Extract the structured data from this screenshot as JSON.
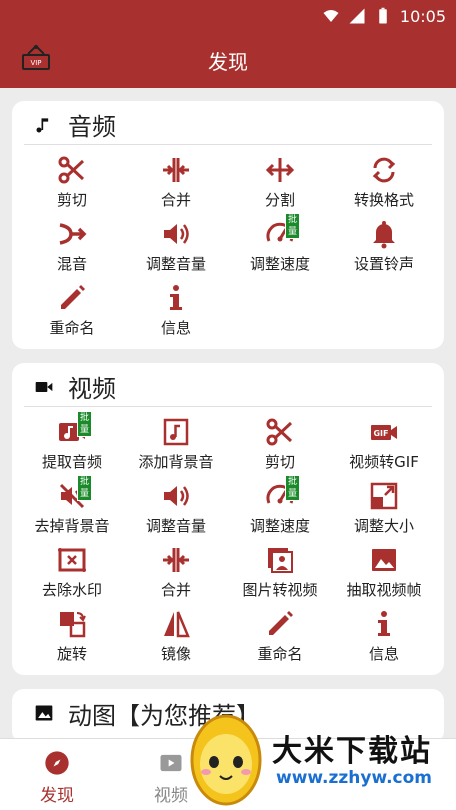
{
  "status": {
    "time": "10:05"
  },
  "appbar": {
    "title": "发现"
  },
  "colors": {
    "accent": "#a8312f",
    "badge": "#1a8a2a"
  },
  "audio": {
    "title": "音频",
    "tools": [
      {
        "label": "剪切",
        "icon": "scissors-icon"
      },
      {
        "label": "合并",
        "icon": "merge-icon"
      },
      {
        "label": "分割",
        "icon": "split-icon"
      },
      {
        "label": "转换格式",
        "icon": "convert-icon"
      },
      {
        "label": "混音",
        "icon": "mix-icon"
      },
      {
        "label": "调整音量",
        "icon": "volume-icon"
      },
      {
        "label": "调整速度",
        "icon": "speed-icon",
        "badge": "批量"
      },
      {
        "label": "设置铃声",
        "icon": "bell-icon"
      },
      {
        "label": "重命名",
        "icon": "pencil-icon"
      },
      {
        "label": "信息",
        "icon": "info-icon"
      }
    ]
  },
  "video": {
    "title": "视频",
    "tools": [
      {
        "label": "提取音频",
        "icon": "extract-audio-icon",
        "badge": "批量"
      },
      {
        "label": "添加背景音",
        "icon": "music-note-icon"
      },
      {
        "label": "剪切",
        "icon": "scissors-icon"
      },
      {
        "label": "视频转GIF",
        "icon": "gif-icon"
      },
      {
        "label": "去掉背景音",
        "icon": "mute-icon",
        "badge": "批量"
      },
      {
        "label": "调整音量",
        "icon": "volume-icon"
      },
      {
        "label": "调整速度",
        "icon": "speed-icon",
        "badge": "批量"
      },
      {
        "label": "调整大小",
        "icon": "resize-icon"
      },
      {
        "label": "去除水印",
        "icon": "watermark-icon"
      },
      {
        "label": "合并",
        "icon": "merge-icon"
      },
      {
        "label": "图片转视频",
        "icon": "photos-icon"
      },
      {
        "label": "抽取视频帧",
        "icon": "image-icon"
      },
      {
        "label": "旋转",
        "icon": "rotate-icon"
      },
      {
        "label": "镜像",
        "icon": "mirror-icon"
      },
      {
        "label": "重命名",
        "icon": "pencil-icon"
      },
      {
        "label": "信息",
        "icon": "info-icon"
      }
    ]
  },
  "gif": {
    "title": "动图【为您推荐】"
  },
  "nav": {
    "discover": "发现",
    "video": "视频"
  },
  "watermark": {
    "text": "大米下载站",
    "url": "www.zzhyw.com"
  }
}
